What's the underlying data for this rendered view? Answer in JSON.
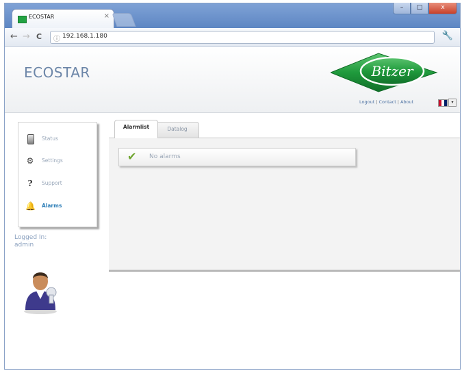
{
  "browser": {
    "tab_title": "ECOSTAR",
    "tab_close": "×",
    "url": "192.168.1.180",
    "nav": {
      "back": "←",
      "forward": "→",
      "reload": "C"
    },
    "window_buttons": {
      "minimize": "–",
      "maximize": "□",
      "close": "x"
    }
  },
  "header": {
    "app_title": "ECOSTAR",
    "logo_text": "Bitzer",
    "links": {
      "logout": "Logout",
      "contact": "Contact",
      "about": "About"
    },
    "separator": "|",
    "language_dropdown": "▾"
  },
  "sidebar": {
    "items": [
      {
        "label": "Status",
        "icon": "status-icon"
      },
      {
        "label": "Settings",
        "icon": "gear-icon"
      },
      {
        "label": "Support",
        "icon": "question-icon"
      },
      {
        "label": "Alarms",
        "icon": "alarm-icon"
      }
    ],
    "active_index": 3,
    "logged_in_label": "Logged In:",
    "user": "admin"
  },
  "content": {
    "tabs": [
      {
        "label": "Alarmlist"
      },
      {
        "label": "Datalog"
      }
    ],
    "active_tab": 0,
    "alarm_message": "No alarms"
  },
  "colors": {
    "accent": "#2f7fb8",
    "title": "#6c86a8",
    "logo_green": "#1f9a3c",
    "check_green": "#6fa52f"
  }
}
